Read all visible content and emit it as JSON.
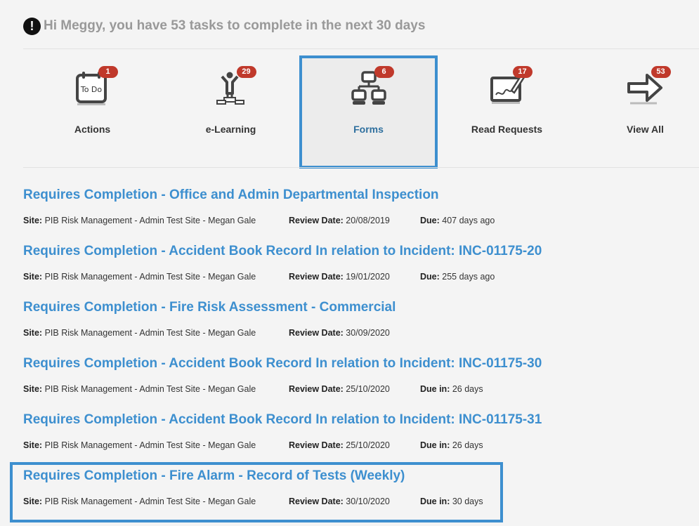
{
  "greeting": "Hi Meggy, you have 53 tasks to complete in the next 30 days",
  "tiles": [
    {
      "label": "Actions",
      "count": "1",
      "icon": "todo-calendar-icon"
    },
    {
      "label": "e-Learning",
      "count": "29",
      "icon": "podium-person-icon"
    },
    {
      "label": "Forms",
      "count": "6",
      "icon": "forms-hierarchy-icon",
      "active": true
    },
    {
      "label": "Read Requests",
      "count": "17",
      "icon": "signature-pen-icon"
    },
    {
      "label": "View All",
      "count": "53",
      "icon": "arrow-right-icon"
    }
  ],
  "labels": {
    "site": "Site:",
    "review": "Review Date:",
    "due_past": "Due:",
    "due_in": "Due in:"
  },
  "tasks": [
    {
      "title": "Requires Completion - Office and Admin Departmental Inspection",
      "site": "PIB Risk Management - Admin Test Site - Megan Gale",
      "review_date": "20/08/2019",
      "due_label": "Due:",
      "due": "407 days ago"
    },
    {
      "title": "Requires Completion - Accident Book Record In relation to Incident: INC-01175-20",
      "site": "PIB Risk Management - Admin Test Site - Megan Gale",
      "review_date": "19/01/2020",
      "due_label": "Due:",
      "due": "255 days ago"
    },
    {
      "title": "Requires Completion - Fire Risk Assessment - Commercial",
      "site": "PIB Risk Management - Admin Test Site - Megan Gale",
      "review_date": "30/09/2020",
      "due_label": "",
      "due": ""
    },
    {
      "title": "Requires Completion - Accident Book Record In relation to Incident: INC-01175-30",
      "site": "PIB Risk Management - Admin Test Site - Megan Gale",
      "review_date": "25/10/2020",
      "due_label": "Due in:",
      "due": "26 days"
    },
    {
      "title": "Requires Completion - Accident Book Record In relation to Incident: INC-01175-31",
      "site": "PIB Risk Management - Admin Test Site - Megan Gale",
      "review_date": "25/10/2020",
      "due_label": "Due in:",
      "due": "26 days"
    },
    {
      "title": "Requires Completion - Fire Alarm - Record of Tests (Weekly)",
      "site": "PIB Risk Management - Admin Test Site - Megan Gale",
      "review_date": "30/10/2020",
      "due_label": "Due in:",
      "due": "30 days"
    }
  ],
  "colors": {
    "accent": "#3d8fcf",
    "badge": "#c0392b",
    "greeting": "#999999"
  }
}
